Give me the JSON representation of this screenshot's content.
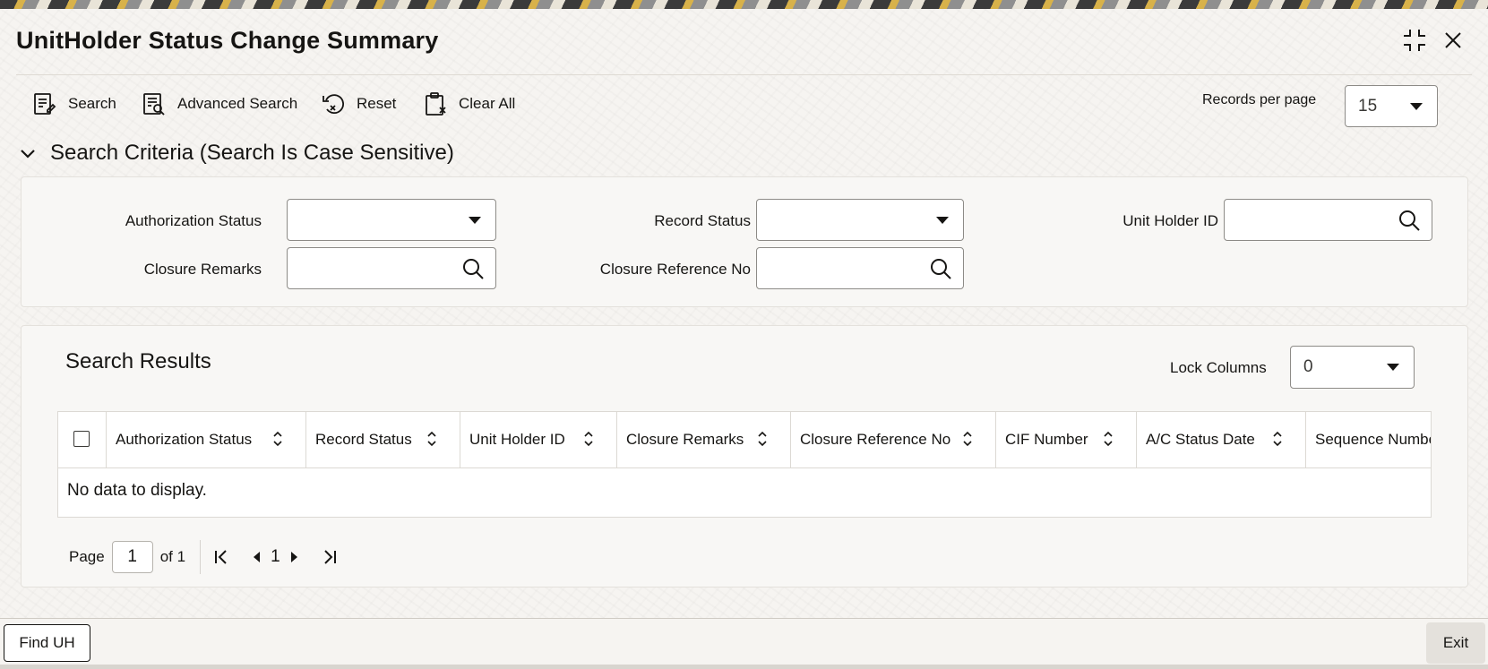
{
  "window": {
    "title": "UnitHolder Status Change Summary"
  },
  "toolbar": {
    "search_label": "Search",
    "advanced_search_label": "Advanced Search",
    "reset_label": "Reset",
    "clear_all_label": "Clear All",
    "records_per_page_label": "Records per page",
    "records_per_page_value": "15"
  },
  "criteria": {
    "header": "Search Criteria (Search Is Case Sensitive)",
    "authorization_status_label": "Authorization Status",
    "authorization_status_value": "",
    "record_status_label": "Record Status",
    "record_status_value": "",
    "unit_holder_id_label": "Unit Holder ID",
    "unit_holder_id_value": "",
    "closure_remarks_label": "Closure Remarks",
    "closure_remarks_value": "",
    "closure_reference_no_label": "Closure Reference No",
    "closure_reference_no_value": ""
  },
  "results": {
    "title": "Search Results",
    "lock_columns_label": "Lock Columns",
    "lock_columns_value": "0",
    "columns": [
      "Authorization Status",
      "Record Status",
      "Unit Holder ID",
      "Closure Remarks",
      "Closure Reference No",
      "CIF Number",
      "A/C Status Date",
      "Sequence Number"
    ],
    "empty_message": "No data to display.",
    "rows": []
  },
  "pagination": {
    "page_label": "Page",
    "current_page": "1",
    "of_label": "of 1",
    "page_indicator": "1"
  },
  "footer": {
    "find_uh_label": "Find UH",
    "exit_label": "Exit"
  },
  "icons": {
    "maximize": "maximize-icon",
    "close": "close-icon",
    "search": "search-icon",
    "advanced_search": "advanced-search-icon",
    "reset": "reset-icon",
    "clear_all": "clear-all-icon",
    "collapse": "chevron-down-icon",
    "sort": "sort-icon",
    "first_page": "first-page-icon",
    "prev_page": "previous-page-icon",
    "next_page": "next-page-icon",
    "last_page": "last-page-icon"
  }
}
